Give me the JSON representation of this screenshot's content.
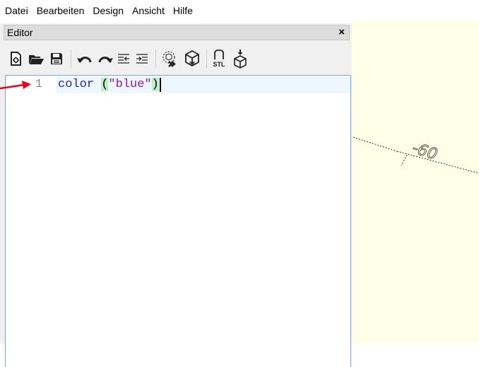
{
  "menubar": {
    "items": [
      "Datei",
      "Bearbeiten",
      "Design",
      "Ansicht",
      "Hilfe"
    ]
  },
  "editor_panel": {
    "title": "Editor",
    "close_glyph": "×",
    "toolbar": {
      "buttons": [
        "new-file-icon",
        "open-folder-icon",
        "save-icon",
        "undo-icon",
        "redo-icon",
        "unindent-icon",
        "indent-icon",
        "preview-icon",
        "render-icon",
        "export-stl-icon",
        "send-to-printer-icon"
      ],
      "stl_label": "STL"
    },
    "code": {
      "line_number": "1",
      "ident": "color",
      "space": " ",
      "paren_open": "(",
      "string": "\"blue\"",
      "paren_close": ")"
    }
  },
  "viewport": {
    "axis_label": "-60",
    "background": "#ffffe7"
  },
  "colors": {
    "annotation_arrow": "#e8001c",
    "editor_border": "#7aa7d8",
    "string": "#8a1ea0",
    "identifier": "#2a2a96"
  }
}
